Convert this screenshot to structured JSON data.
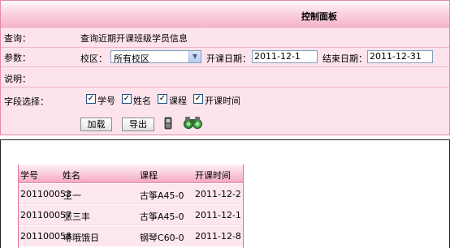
{
  "panel": {
    "title": "控制面板",
    "query_label": "查询：",
    "query_text": "查询近期开课班级学员信息",
    "params_label": "参数：",
    "campus_label": "校区：",
    "campus_selected": "所有校区",
    "start_label": "开课日期：",
    "start_value": "2011-12-1",
    "end_label": "结束日期：",
    "end_value": "2011-12-31",
    "desc_label": "说明：",
    "fields_label": "字段选择：",
    "fields": [
      {
        "label": "学号",
        "checked": true
      },
      {
        "label": "姓名",
        "checked": true
      },
      {
        "label": "课程",
        "checked": true
      },
      {
        "label": "开课时间",
        "checked": true
      }
    ],
    "load_button": "加载",
    "export_button": "导出",
    "icons": [
      "phone-icon",
      "binoculars-icon"
    ]
  },
  "grid": {
    "columns": [
      "学号",
      "姓名",
      "课程",
      "开课时间"
    ],
    "rows": [
      [
        "201100053",
        "王一",
        "古筝A45-0",
        "2011-12-2"
      ],
      [
        "201100057",
        "张三丰",
        "古筝A45-0",
        "2011-12-1"
      ],
      [
        "201100058",
        "哧哦饿日",
        "钢琴C60-0",
        "2011-12-8"
      ]
    ]
  },
  "colors": {
    "panel_bg": "#fde3ec",
    "header_pink": "#f7b5cb",
    "border_pink": "#e38aa8",
    "row_bg": "#fde7ef"
  }
}
